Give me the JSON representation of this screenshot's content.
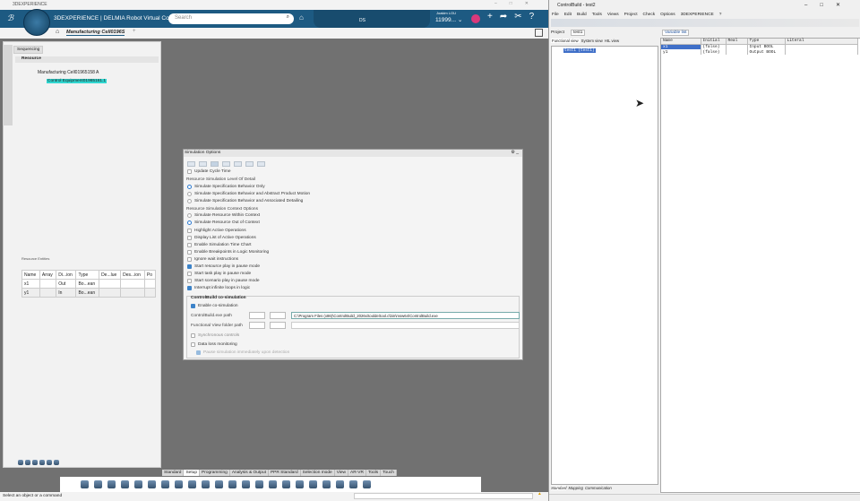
{
  "app": {
    "window_title": "3DEXPERIENCE",
    "brand": "3DEXPERIENCE | DELMIA Robot Virtual Com...",
    "search_placeholder": "Search",
    "ds": "DS",
    "user_name": "Joakim LOU",
    "user_value": "11999...",
    "tab_title": "Manufacturing Cell0196S",
    "add_tab": "+"
  },
  "left_panel": {
    "tab": "Sequencing",
    "section": "Resource",
    "tree": [
      {
        "label": "Manufacturing Cell01965158 A"
      },
      {
        "label": "Control Equipment01965161.1",
        "selected": true
      }
    ],
    "entities": {
      "title": "Resource Entities",
      "columns": [
        "Name",
        "Array",
        "Di...ion",
        "Type",
        "De...lue",
        "Des...ion",
        "Po"
      ],
      "rows": [
        [
          "x1",
          "",
          "Out",
          "Bo...ean",
          "",
          "",
          ""
        ],
        [
          "y1",
          "",
          "In",
          "Bo...ean",
          "",
          "",
          ""
        ]
      ]
    }
  },
  "dialog": {
    "title": "Simulation Options",
    "update_cycle": {
      "label": "Update Cycle Time",
      "checked": false
    },
    "lod_title": "Resource Simulation Level Of Detail",
    "lod": [
      {
        "label": "Simulate Specification Behavior Only",
        "checked": true
      },
      {
        "label": "Simulate Specification Behavior and Abstract Product Motion",
        "checked": false
      },
      {
        "label": "Simulate Specification Behavior and Associated Detailing",
        "checked": false
      }
    ],
    "ctx_title": "Resource Simulation Context Options",
    "ctx": [
      {
        "label": "Simulate Resource Within Context",
        "checked": false
      },
      {
        "label": "Simulate Resource Out of Context",
        "checked": true
      }
    ],
    "options": [
      {
        "label": "Highlight Active Operations",
        "checked": false
      },
      {
        "label": "Display List of Active Operations",
        "checked": false
      },
      {
        "label": "Enable Simulation Time Chart",
        "checked": false
      },
      {
        "label": "Enable Breakpoints in Logic Monitoring",
        "checked": false
      },
      {
        "label": "Ignore wait instructions",
        "checked": false
      },
      {
        "label": "Start resource play in pause mode",
        "checked": true
      },
      {
        "label": "Start task play in pause mode",
        "checked": false
      },
      {
        "label": "Start scenario play in pause mode",
        "checked": false
      },
      {
        "label": "Interrupt infinite loops in logic",
        "checked": true
      }
    ],
    "cosim": {
      "title": "ControlBuild co-simulation",
      "enable": {
        "label": "Enable co-simulation",
        "checked": true
      },
      "exe_label": "ControlBuild.exe path",
      "exe_value": "C:\\Program Files (x86)\\ControlBuild_2026x\\toolde\\tool.c\\bin\\msw64\\ControlBuild.exe",
      "folder_label": "Functional View folder path",
      "folder_value": "",
      "sync": {
        "label": "Synchronous controls",
        "checked": false
      },
      "dataloss": {
        "label": "Data loss monitoring",
        "checked": false
      },
      "pause": {
        "label": "Pause simulation immediately upon detection",
        "checked": true
      }
    }
  },
  "bottom_tabs": [
    "Standard",
    "Setup",
    "Programming",
    "Analysis & Output",
    "PPR Standard",
    "Selection mode",
    "View",
    "AR-VR",
    "Tools",
    "Touch"
  ],
  "active_bottom_tab": "Setup",
  "status": "Select an object or a command",
  "cb": {
    "title": "ControlBuild - test2",
    "menu": [
      "File",
      "Edit",
      "Build",
      "Tools",
      "Views",
      "Project",
      "Check",
      "Options",
      "3DEXPERIENCE",
      "?"
    ],
    "project_label": "Project",
    "project_tab": "test1",
    "views": [
      "Functional view",
      "System view",
      "HIL view"
    ],
    "tree_item": "test1 (test1)",
    "var_tab": "Variable list",
    "columns": [
      "Name",
      "Initial",
      "Real",
      "Type",
      "Literal"
    ],
    "rows": [
      [
        "x1",
        "(false)",
        "",
        "Input BOOL",
        ""
      ],
      [
        "y1",
        "(false)",
        "",
        "Output BOOL",
        ""
      ]
    ],
    "bottom_tabs": [
      "Standard",
      "Mapping",
      "Communication"
    ]
  }
}
